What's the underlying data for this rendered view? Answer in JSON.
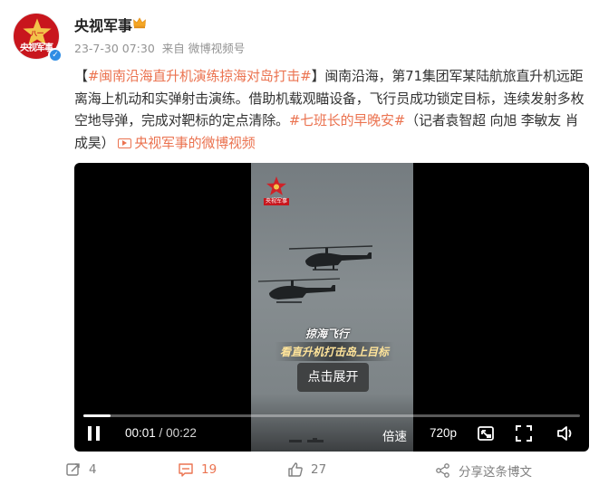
{
  "author": {
    "name": "央视军事",
    "avatar_label": "央视军事",
    "badge_color": "#f5a623",
    "verified_icon": "v-badge"
  },
  "post": {
    "time": "23-7-30 07:30",
    "source": "来自 微博视频号",
    "bracket_open": "【",
    "topic_title": "#闽南沿海直升机演练掠海对岛打击#",
    "bracket_close": "】",
    "body": "闽南沿海，第71集团军某陆航旅直升机远距离海上机动和实弹射击演练。借助机载观瞄设备，飞行员成功锁定目标，连续发射多枚空地导弹，完成对靶标的定点清除。",
    "topic_tag": "#七班长的早晚安#",
    "reporters": "（记者袁智超 向旭 李敏友 肖成昊）",
    "video_link": "央视军事的微博视频",
    "link_color": "#eb7350"
  },
  "video": {
    "watermark": "央视军事",
    "caption_line1": "掠海飞行",
    "caption_line2": "看直升机打击岛上目标",
    "expand_label": "点击展开",
    "current_time": "00:01",
    "separator": " / ",
    "total_time": "00:22",
    "progress_fraction": 0.055,
    "speed_label": "倍速",
    "quality_label": "720p",
    "icons": [
      "pause-icon",
      "picture-in-picture-icon",
      "fullscreen-icon",
      "volume-icon"
    ]
  },
  "actions": {
    "repost_count": "4",
    "comment_count": "19",
    "like_count": "27",
    "share_label": "分享这条博文",
    "icons": [
      "repost-icon",
      "comment-icon",
      "like-icon",
      "share-icon"
    ]
  }
}
